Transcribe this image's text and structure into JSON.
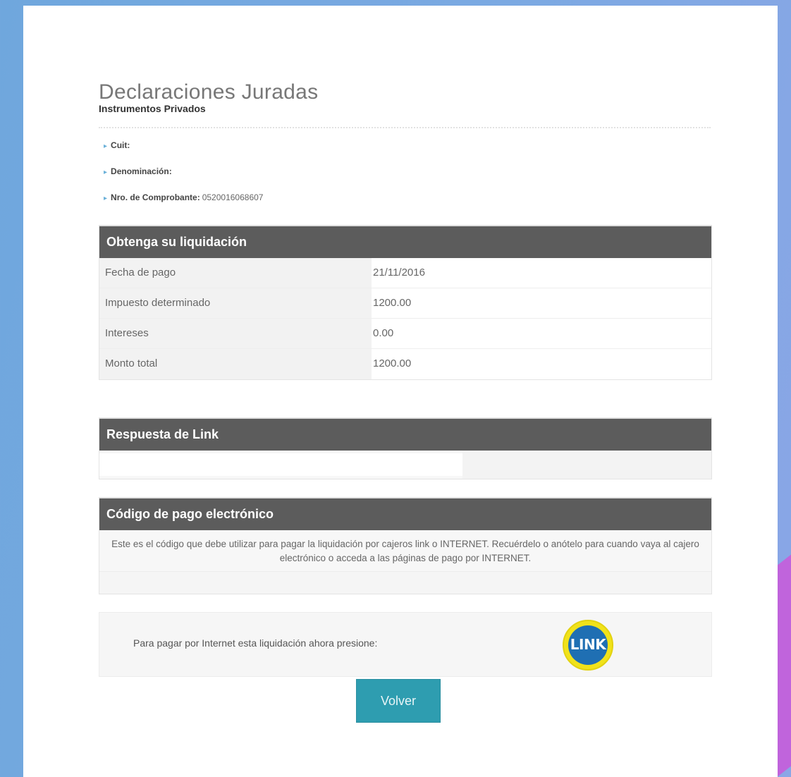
{
  "page": {
    "title": "Declaraciones Juradas",
    "subtitle": "Instrumentos Privados"
  },
  "info": [
    {
      "label": "Cuit:",
      "value": ""
    },
    {
      "label": "Denominación:",
      "value": ""
    },
    {
      "label": "Nro. de Comprobante:",
      "value": "0520016068607"
    }
  ],
  "liquidacion": {
    "header": "Obtenga su liquidación",
    "rows": [
      {
        "label": "Fecha de pago",
        "value": "21/11/2016"
      },
      {
        "label": "Impuesto determinado",
        "value": "1200.00"
      },
      {
        "label": "Intereses",
        "value": "0.00"
      },
      {
        "label": "Monto total",
        "value": "1200.00"
      }
    ]
  },
  "link_response": {
    "header": "Respuesta de Link",
    "value": ""
  },
  "codigo_pago": {
    "header": "Código de pago electrónico",
    "description": "Este es el código que debe utilizar para pagar la liquidación por cajeros link o INTERNET. Recuérdelo o anótelo para cuando vaya al cajero electrónico o acceda a las páginas de pago por INTERNET.",
    "code": ""
  },
  "pago_internet": {
    "text": "Para pagar por Internet esta liquidación ahora presione:",
    "logo_text": "LINK",
    "logo_icon": "link-pagos-logo"
  },
  "actions": {
    "volver_label": "Volver"
  },
  "colors": {
    "header_bg": "#5c5c5c",
    "button_bg": "#2e9db0",
    "background_blue": "#7ba9e2",
    "accent_purple": "#c064dc"
  }
}
